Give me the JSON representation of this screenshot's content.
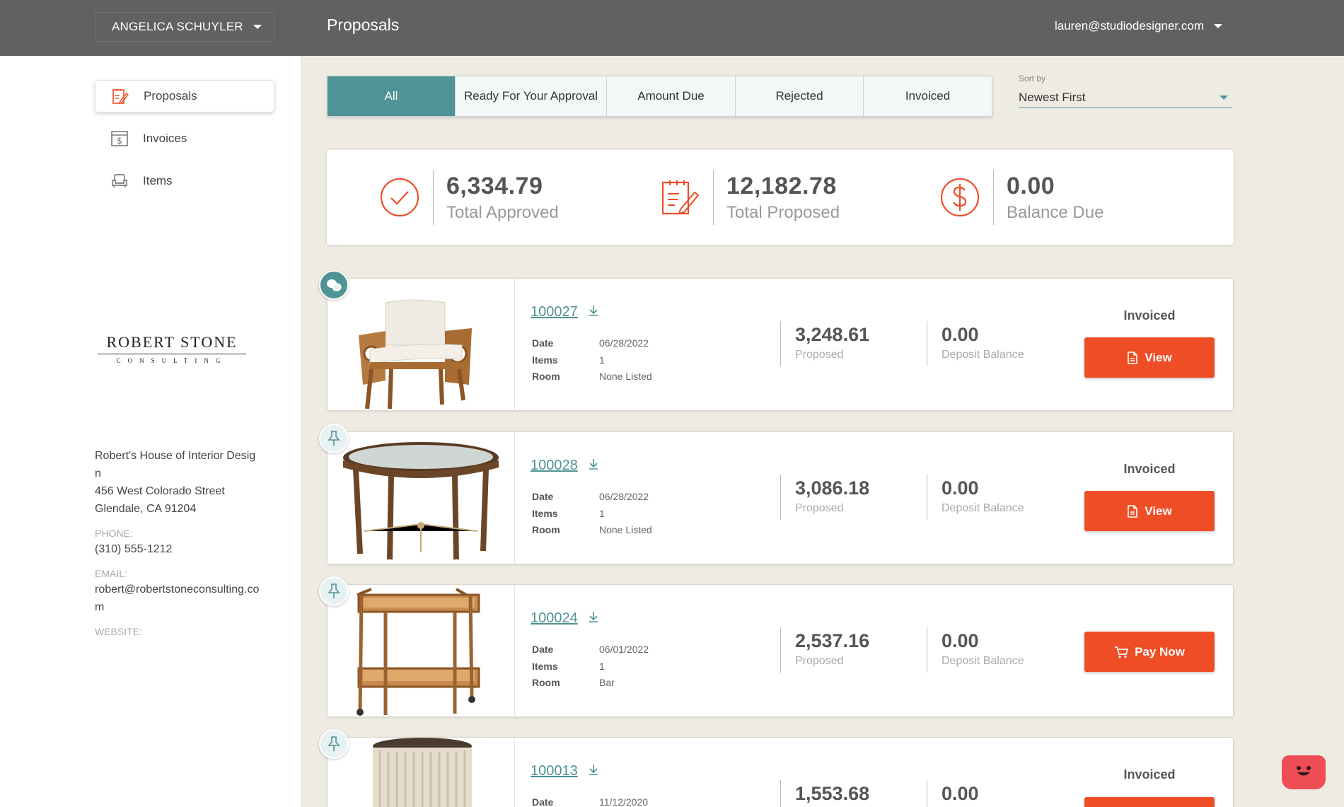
{
  "topbar": {
    "client_name": "ANGELICA SCHUYLER",
    "page_title": "Proposals",
    "user_email": "lauren@studiodesigner.com"
  },
  "sidebar": {
    "items": [
      {
        "label": "Proposals",
        "icon": "proposal-edit-icon",
        "active": true
      },
      {
        "label": "Invoices",
        "icon": "invoice-dollar-icon",
        "active": false
      },
      {
        "label": "Items",
        "icon": "armchair-icon",
        "active": false
      }
    ],
    "logo": {
      "line1": "ROBERT STONE",
      "line2": "CONSULTING"
    },
    "contact": {
      "company": "Robert's House of Interior Design",
      "street": "456 West Colorado Street",
      "city": "Glendale, CA 91204",
      "phone_label": "PHONE:",
      "phone": "(310) 555-1212",
      "email_label": "EMAIL:",
      "email": "robert@robertstoneconsulting.com",
      "website_label": "WEBSITE:"
    }
  },
  "filters": {
    "tabs": [
      "All",
      "Ready For Your Approval",
      "Amount Due",
      "Rejected",
      "Invoiced"
    ],
    "active_index": 0,
    "sort_label": "Sort by",
    "sort_value": "Newest First"
  },
  "summary": {
    "approved": {
      "value": "6,334.79",
      "label": "Total Approved"
    },
    "proposed": {
      "value": "12,182.78",
      "label": "Total Proposed"
    },
    "balance": {
      "value": "0.00",
      "label": "Balance Due"
    }
  },
  "proposals": [
    {
      "id": "100027",
      "date_label": "Date",
      "date": "06/28/2022",
      "items_label": "Items",
      "items": "1",
      "room_label": "Room",
      "room": "None Listed",
      "proposed": "3,248.61",
      "proposed_label": "Proposed",
      "deposit": "0.00",
      "deposit_label": "Deposit Balance",
      "status": "Invoiced",
      "action": "View",
      "badge": "chat-bubbles-icon",
      "image": "armchair"
    },
    {
      "id": "100028",
      "date_label": "Date",
      "date": "06/28/2022",
      "items_label": "Items",
      "items": "1",
      "room_label": "Room",
      "room": "None Listed",
      "proposed": "3,086.18",
      "proposed_label": "Proposed",
      "deposit": "0.00",
      "deposit_label": "Deposit Balance",
      "status": "Invoiced",
      "action": "View",
      "badge": "pin-icon",
      "image": "round-table"
    },
    {
      "id": "100024",
      "date_label": "Date",
      "date": "06/01/2022",
      "items_label": "Items",
      "items": "1",
      "room_label": "Room",
      "room": "Bar",
      "proposed": "2,537.16",
      "proposed_label": "Proposed",
      "deposit": "0.00",
      "deposit_label": "Deposit Balance",
      "status": "",
      "action": "Pay Now",
      "badge": "pin-icon",
      "image": "bar-cart"
    },
    {
      "id": "100013",
      "date_label": "Date",
      "date": "11/12/2020",
      "proposed": "1,553.68",
      "deposit": "0.00",
      "status": "Invoiced",
      "badge": "pin-icon",
      "image": "side-table"
    }
  ],
  "colors": {
    "teal": "#4f9394",
    "orange": "#ee4d25",
    "topbar": "#5f6163",
    "background": "#eeebe3"
  }
}
